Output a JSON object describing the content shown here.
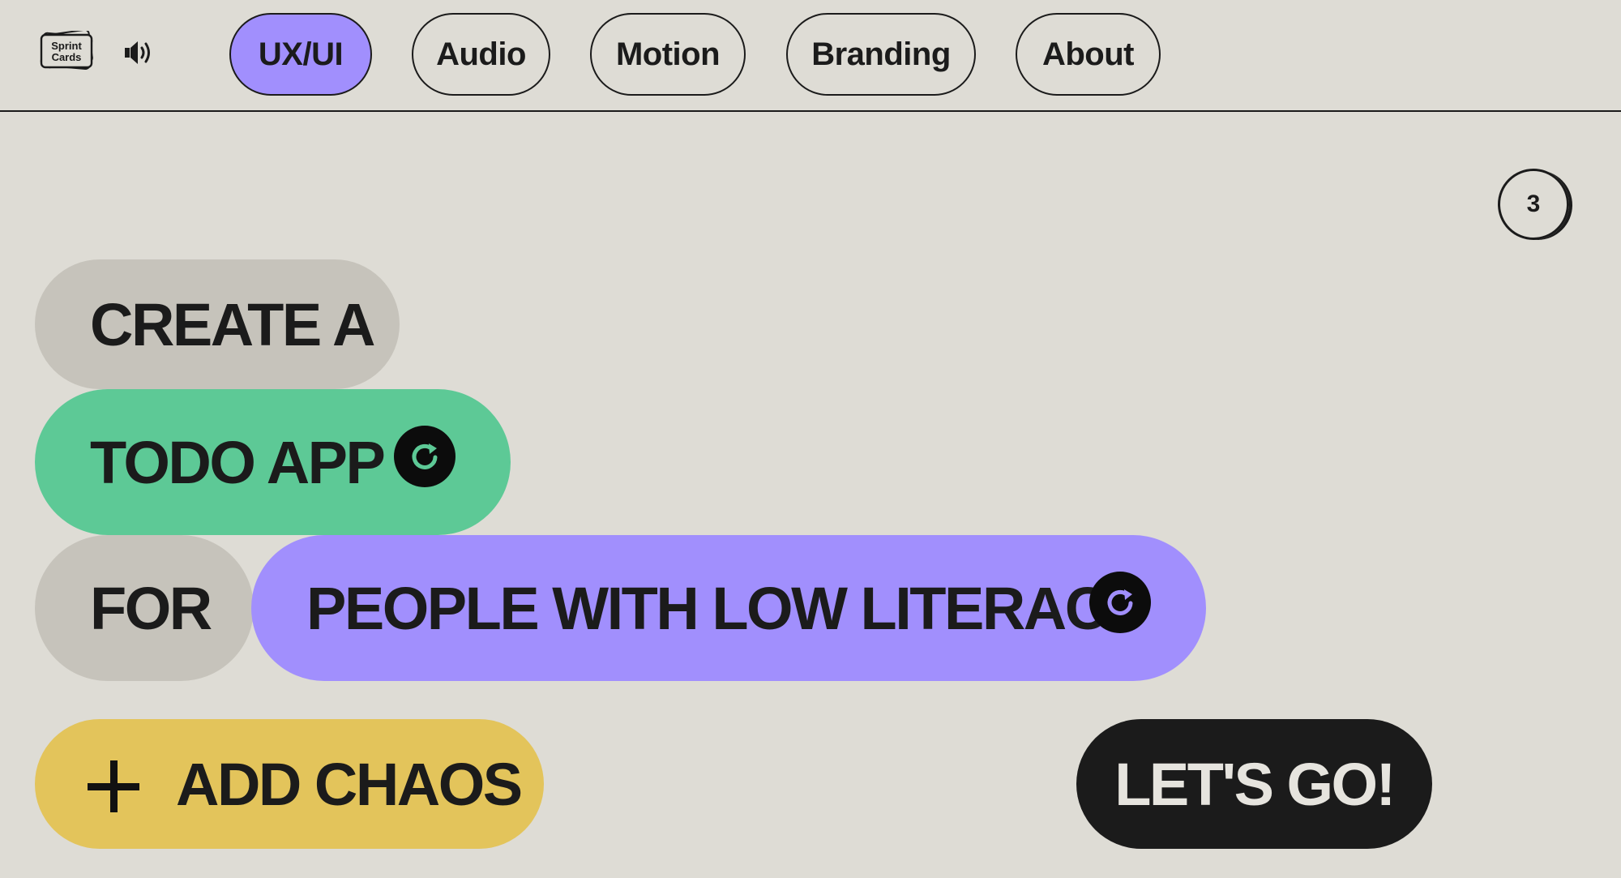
{
  "header": {
    "logo": {
      "line1": "Sprint",
      "line2": "Cards",
      "icon": "sprint-cards-logo"
    },
    "sound": {
      "icon": "speaker-icon"
    },
    "tabs": [
      {
        "label": "UX/UI",
        "active": true
      },
      {
        "label": "Audio",
        "active": false
      },
      {
        "label": "Motion",
        "active": false
      },
      {
        "label": "Branding",
        "active": false
      },
      {
        "label": "About",
        "active": false
      }
    ]
  },
  "counter": {
    "value": "3"
  },
  "prompt": {
    "line1": "CREATE A",
    "subject": "TODO APP",
    "connector": "FOR",
    "audience": "PEOPLE WITH LOW LITERACY",
    "refresh_icon": "refresh-icon"
  },
  "actions": {
    "add_chaos": "ADD CHAOS",
    "add_icon": "plus-icon",
    "go": "LET'S GO!"
  },
  "colors": {
    "background": "#dedcd5",
    "accent_purple": "#a18ffd",
    "accent_green": "#5dc996",
    "accent_yellow": "#e3c45b",
    "neutral_pill": "#c6c3bb",
    "dark": "#1b1b1b"
  }
}
